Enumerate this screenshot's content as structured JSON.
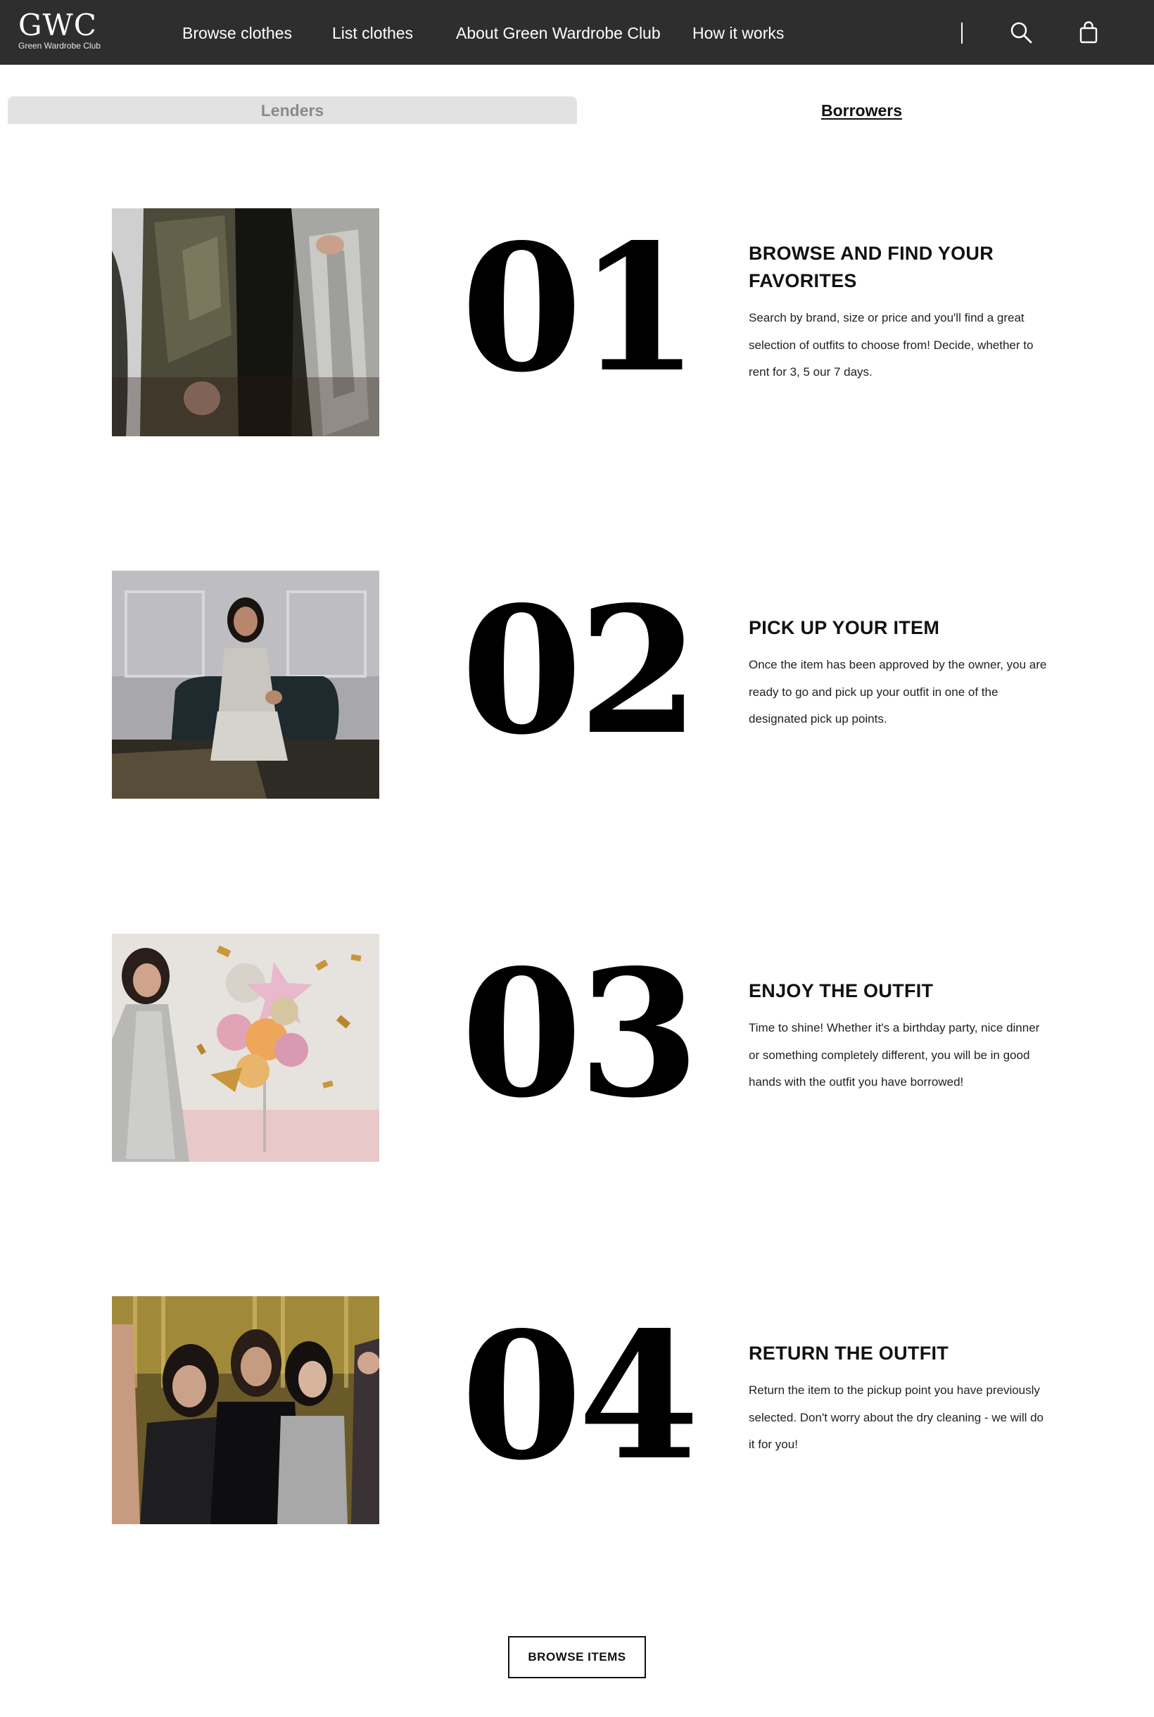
{
  "header": {
    "logo_mark": "GWC",
    "logo_subtitle": "Green Wardrobe Club",
    "nav": [
      {
        "label": "Browse clothes"
      },
      {
        "label": "List clothes"
      },
      {
        "label": "About Green Wardrobe Club"
      },
      {
        "label": "How it works"
      }
    ],
    "icons": [
      "search-icon",
      "shopping-bag-icon"
    ],
    "background_color": "#2e2e2e"
  },
  "tabs": {
    "lenders": "Lenders",
    "borrowers": "Borrowers",
    "active": "Borrowers"
  },
  "steps": [
    {
      "number": "01",
      "title": "BROWSE AND FIND YOUR FAVORITES",
      "description": "Search by brand, size or price and you'll find a great selection of outfits to choose from! Decide, whether to rent for 3, 5 our 7 days.",
      "image": "photo-sequin-outfits"
    },
    {
      "number": "02",
      "title": "PICK UP YOUR ITEM",
      "description": "Once the item has been approved by the owner, you are ready to go and pick up your outfit in one of the designated pick up points.",
      "image": "photo-woman-silver-dress"
    },
    {
      "number": "03",
      "title": "ENJOY THE OUTFIT",
      "description": "Time to shine! Whether it's a birthday party, nice dinner or something completely different, you will be in good hands with the outfit you have borrowed!",
      "image": "photo-balloons-party"
    },
    {
      "number": "04",
      "title": "RETURN THE OUTFIT",
      "description": "Return the item to the pickup point you have previously selected. Don't worry about the dry cleaning - we will do it for you!",
      "image": "photo-group-of-women"
    }
  ],
  "cta": {
    "browse_label": "BROWSE ITEMS"
  }
}
